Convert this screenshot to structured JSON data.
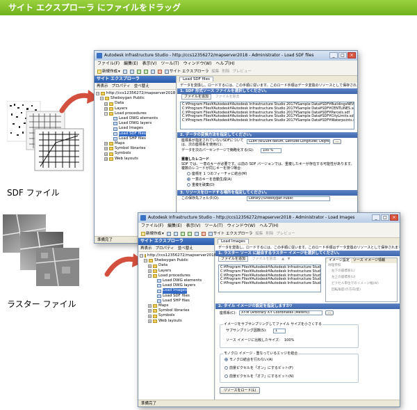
{
  "banner": {
    "title": "サイト エクスプローラ にファイルをドラッグ"
  },
  "captions": {
    "sdf": "SDF ファイル",
    "raster": "ラスター ファイル"
  },
  "window1": {
    "title": "Autodesk Infrastructure Studio - http://ccs12356272/mapserver2018 - Administrator - Load SDF files",
    "menu": [
      "ファイル(F)",
      "編集(E)",
      "表示(V)",
      "ツール(T)",
      "ウィンドウ(W)",
      "ヘルプ(H)"
    ],
    "toolbar": {
      "new": "新規作成",
      "site_explorer": "サイト エクスプローラ",
      "edit": "編集",
      "delete": "削除",
      "preview": "プレビュー"
    },
    "explorer": {
      "title": "サイト エクスプローラ",
      "refresh": "再表示",
      "properties": "プロパティ",
      "sort": "並べ替え",
      "tree": [
        {
          "label": "http://ccs12356272/mapserver2018",
          "level": 0
        },
        {
          "label": "Sheboygan Public",
          "level": 1
        },
        {
          "label": "Data",
          "level": 2
        },
        {
          "label": "Layers",
          "level": 2
        },
        {
          "label": "Load procedures",
          "level": 2
        },
        {
          "label": "Load DWG elements",
          "level": 3
        },
        {
          "label": "Load DWG layers",
          "level": 3
        },
        {
          "label": "Load Images",
          "level": 3
        },
        {
          "label": "Load SDF files",
          "level": 3,
          "selected": true
        },
        {
          "label": "Load SHP files",
          "level": 3
        },
        {
          "label": "Maps",
          "level": 2
        },
        {
          "label": "Symbol libraries",
          "level": 2
        },
        {
          "label": "Symbols",
          "level": 2
        },
        {
          "label": "Web layouts",
          "level": 2
        }
      ]
    },
    "tab": "Load SDF files",
    "description": "データを変換し、ロードするには、この手順に従います。このロード手順はデータ変換のリソースとして保存されます。",
    "section1": "1. SDF 形式ソース ファイルを選択してください。",
    "add_file": "ファイルを追加",
    "remove_file": "ファイルを除去",
    "files": [
      "C:¥Program Files¥Autodesk¥Autodesk Infrastructure Studio 2017¥Sample Data¥SDF¥BuildingsNEW.sdf",
      "C:¥Program Files¥Autodesk¥Autodesk Infrastructure Studio 2017¥Sample Data¥SDF¥CENTLINES.sdf",
      "C:¥Program Files¥Autodesk¥Autodesk Infrastructure Studio 2017¥Sample Data¥SDF¥Parcels.sdf",
      "C:¥Program Files¥Autodesk¥Autodesk Infrastructure Studio 2017¥Sample Data¥SDF¥CityLimits.sdf",
      "C:¥Program Files¥Autodesk¥Autodesk Infrastructure Studio 2017¥Sample Data¥SDF¥Waterpoints.sdf"
    ],
    "section2": "2. データの変換方法を指定してください。",
    "crs_label": "座標系が指定されていないSDFについては、次の座標系を使用(C):",
    "crs_value": "LL84 (WGS84 datum, Latitude-Longitude; Degrees)",
    "generalize_label": "データを次のパーセンテージで簡略化する(G):",
    "generalize_value": "100 %",
    "dup_heading": "重複したレコード",
    "dup_desc": "SDF では、一意のキーが必要です。以前の SDF バージョンでは、重複したキーが存在する可能性があります。",
    "dup_desc2": "複数のレコードが同じキーを持つ場合:",
    "dup_options": [
      "座標を 1 つのフィーチャに結合(M)",
      "一意のキーを自動生成(A)",
      "重複を破棄(D)"
    ],
    "section3": "3. リソースをロードする場所を指定してください。",
    "target_label": "この保存先フォルダ(O):",
    "target_value": "Library://Sheboygan Public",
    "status": "準備完了"
  },
  "window2": {
    "title": "Autodesk Infrastructure Studio - http://ccs12356272/mapserver2018 - Administrator - Load Images",
    "menu": [
      "ファイル(F)",
      "編集(E)",
      "表示(V)",
      "ツール(T)",
      "ウィンドウ(W)",
      "ヘルプ(H)"
    ],
    "toolbar": {
      "new": "新規作成",
      "site_explorer": "サイト エクスプローラ",
      "edit": "編集",
      "delete": "削除",
      "preview": "プレビュー"
    },
    "explorer": {
      "title": "サイト エクスプローラ",
      "refresh": "再表示",
      "properties": "プロパティ",
      "sort": "並べ替え",
      "tree": [
        {
          "label": "http://ccs12356272/mapserver2018",
          "level": 0
        },
        {
          "label": "Sheboygan Public",
          "level": 1
        },
        {
          "label": "Data",
          "level": 2
        },
        {
          "label": "Layers",
          "level": 2
        },
        {
          "label": "Load procedures",
          "level": 2
        },
        {
          "label": "Load DWG elements",
          "level": 3
        },
        {
          "label": "Load DWG layers",
          "level": 3
        },
        {
          "label": "Load Images",
          "level": 3,
          "selected": true
        },
        {
          "label": "Load SDF files",
          "level": 3
        },
        {
          "label": "Load SHP files",
          "level": 3
        },
        {
          "label": "Maps",
          "level": 2
        },
        {
          "label": "Symbol libraries",
          "level": 2
        },
        {
          "label": "Symbols",
          "level": 2
        },
        {
          "label": "Web layouts",
          "level": 2
        }
      ]
    },
    "tab": "Load Images",
    "description": "データを変換し、ロードするには、この手順に従います。このロード手順はデータ変換のリソースとして保存されます。",
    "section1": "1. ラスター ソース に結合するラスター イメージを選択してください。",
    "add_file": "ファイルを追加",
    "remove_file": "ファイルを除去",
    "files": [
      "C:¥Program Files¥Autodesk¥Autodesk Infrastructure Studio 2017¥Sa",
      "C:¥Program Files¥Autodesk¥Autodesk Infrastructure Studio 2017¥Sa",
      "C:¥Program Files¥Autodesk¥Autodesk Infrastructure Studio 2017¥Sa",
      "C:¥Program Files¥Autodesk¥Autodesk Infrastructure Studio 2017¥Sa",
      "C:¥Program Files¥Autodesk¥Autodesk Infrastructure Studio 2017¥Sa"
    ],
    "side_tabs": [
      "イメージ設定",
      "ソース イメージ情報"
    ],
    "side_group": "地理参照",
    "side_lines": [
      "左下の座標系(L)",
      "左上の座標系(U)",
      "ピクセル単位でのイメージ幅(W)",
      "回転角度(の方向/度)"
    ],
    "section2": "2. タイル イメージの設定を指定しますか?",
    "crs_label": "座標系(C):",
    "crs_value": "XY-M (Arbitrary X-Y Coordinates (Meters))",
    "resample_group": "イメージをサブサンプリングしてファイル サイズを小さくする",
    "resample_label": "サブサンプリング因数(S):",
    "resample_value": "1",
    "ratio_label": "ソース イメージに比較したサイズ:",
    "ratio_value": "100%",
    "mono_group": "モノクロ イメージ - 重なっているエッジを結合",
    "mono_options": [
      "モノクロ結合を行わない(A)",
      "前景ピクセルを「オン」にするビット(F)",
      "前景ピクセルを「オフ」にするビット(N)"
    ],
    "load_button": "リソースをロード(L)",
    "status": "準備完了"
  }
}
